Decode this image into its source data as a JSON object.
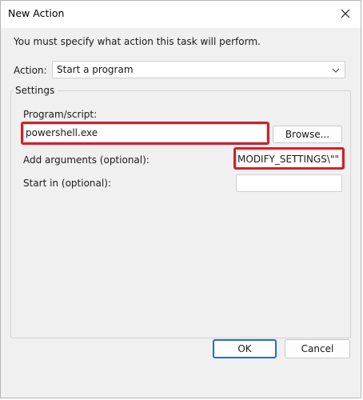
{
  "window": {
    "title": "New Action"
  },
  "dialog": {
    "instruction": "You must specify what action this task will perform.",
    "action_label": "Action:",
    "action_value": "Start a program",
    "settings_label": "Settings",
    "program_label": "Program/script:",
    "program_value": "powershell.exe",
    "browse_label": "Browse...",
    "arguments_label": "Add arguments (optional):",
    "arguments_value": "\\\"MODIFY_SETTINGS\\\"\"",
    "start_in_label": "Start in (optional):",
    "start_in_value": "",
    "ok_label": "OK",
    "cancel_label": "Cancel"
  },
  "icons": {
    "close": "close-icon",
    "dropdown": "chevron-down-icon"
  },
  "colors": {
    "highlight": "#d3202d",
    "primary_button_border": "#1f6fc9"
  }
}
